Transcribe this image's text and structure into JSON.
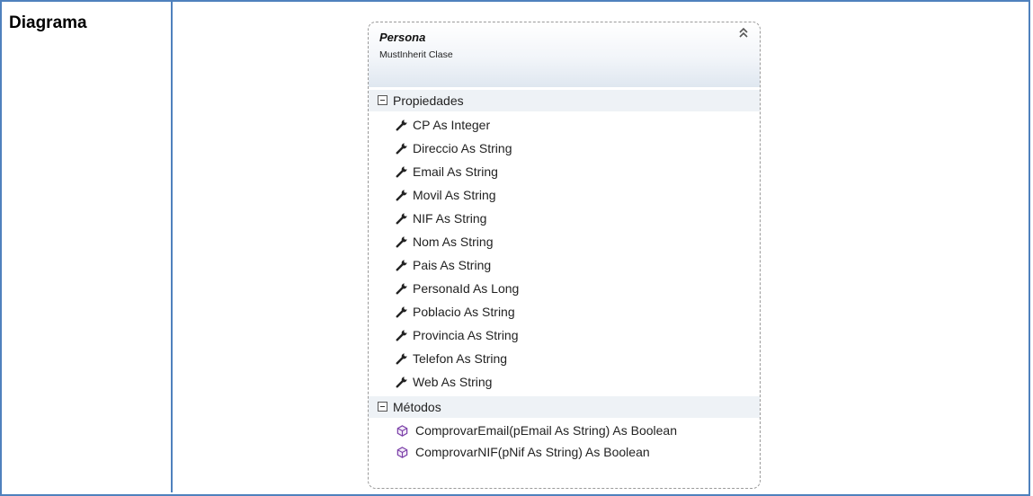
{
  "left_title": "Diagrama",
  "class": {
    "name": "Persona",
    "kind": "MustInherit Clase"
  },
  "sections": {
    "properties": {
      "label": "Propiedades",
      "items": [
        "CP As Integer",
        "Direccio As String",
        "Email As String",
        "Movil As String",
        "NIF As String",
        "Nom As String",
        "Pais As String",
        "PersonaId As Long",
        "Poblacio As String",
        "Provincia As String",
        "Telefon As String",
        "Web As String"
      ]
    },
    "methods": {
      "label": "Métodos",
      "items": [
        "ComprovarEmail(pEmail As String) As Boolean",
        "ComprovarNIF(pNif As String) As Boolean"
      ]
    }
  },
  "icons": {
    "collapse": "double-chevron-up-icon",
    "property": "wrench-icon",
    "method": "method-cube-icon",
    "section_toggle": "minus-box-icon"
  },
  "colors": {
    "border": "#4f81bd",
    "method_icon": "#7b3fa8"
  }
}
